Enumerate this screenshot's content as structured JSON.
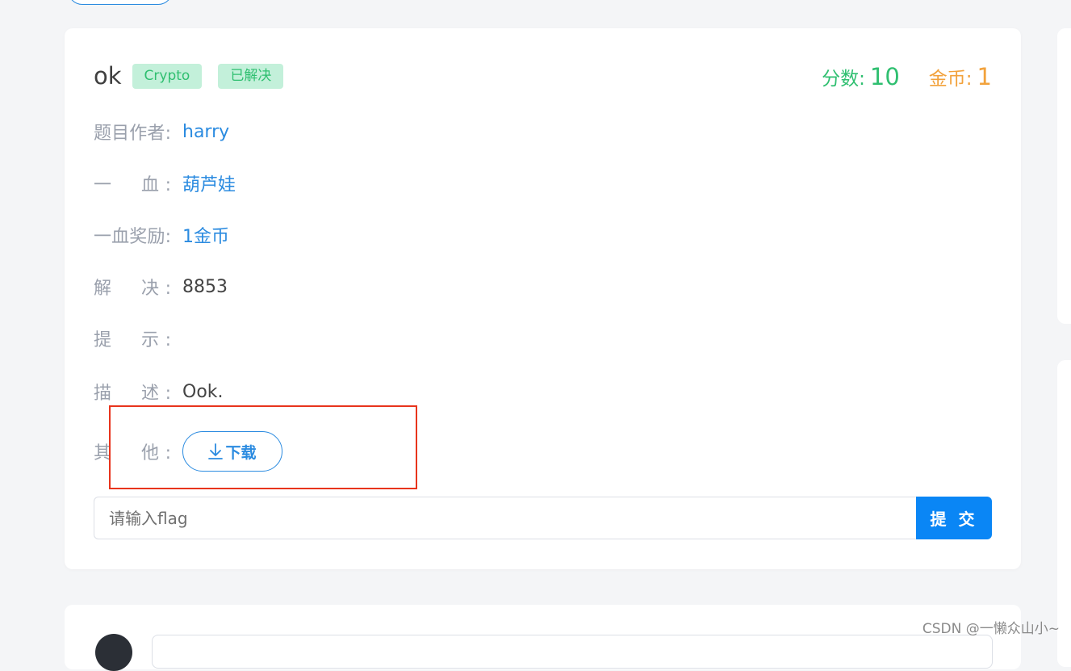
{
  "challenge": {
    "title": "ok",
    "category_tag": "Crypto",
    "status_tag": "已解决",
    "score_label": "分数:",
    "score_value": "10",
    "coin_label": "金币:",
    "coin_value": "1"
  },
  "details": {
    "author_label": "题目作者:",
    "author_value": "harry",
    "first_blood_label": "一　血:",
    "first_blood_value": "葫芦娃",
    "first_blood_reward_label": "一血奖励:",
    "first_blood_reward_value": "1金币",
    "solves_label": "解　决:",
    "solves_value": "8853",
    "hint_label": "提　示:",
    "hint_value": "",
    "description_label": "描　述:",
    "description_value": "Ook.",
    "other_label": "其　他:",
    "download_label": "下载"
  },
  "flag_form": {
    "placeholder": "请输入flag",
    "submit_label": "提 交"
  },
  "watermark": "CSDN @一懒众山小~",
  "colors": {
    "accent_blue": "#2b8be0",
    "submit_blue": "#0a86f5",
    "success_green": "#2fbf70",
    "coin_orange": "#f2a23c",
    "highlight_red": "#e8341c"
  }
}
